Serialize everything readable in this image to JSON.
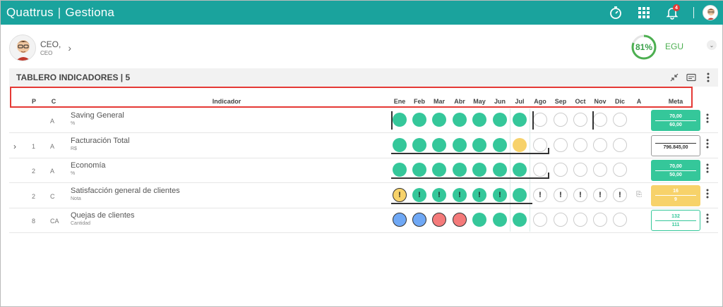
{
  "app": {
    "brand": "Quattrus",
    "module": "Gestiona",
    "notifications": "4"
  },
  "user": {
    "name": "CEO,",
    "role": "CEO"
  },
  "score": {
    "value": "81%",
    "fraction": 0.81,
    "label": "EGU",
    "color": "#4caf50"
  },
  "panel": {
    "title": "TABLERO INDICADORES | 5"
  },
  "columns": {
    "p": "P",
    "c": "C",
    "indicator": "Indicador",
    "months": [
      "Ene",
      "Feb",
      "Mar",
      "Abr",
      "May",
      "Jun",
      "Jul",
      "Ago",
      "Sep",
      "Oct",
      "Nov",
      "Dic"
    ],
    "a": "A",
    "meta": "Meta"
  },
  "rows": [
    {
      "p": "",
      "c": "A",
      "name": "Saving General",
      "unit": "%",
      "expand": false,
      "months": [
        "green",
        "green",
        "green",
        "green",
        "green",
        "green",
        "green",
        "empty",
        "empty",
        "empty",
        "empty",
        "empty"
      ],
      "meta_style": "green",
      "meta_top": "70,00",
      "meta_bottom": "60,00"
    },
    {
      "p": "1",
      "c": "A",
      "name": "Facturación Total",
      "unit": "R$",
      "expand": true,
      "months": [
        "green",
        "green",
        "green",
        "green",
        "green",
        "green",
        "yellow",
        "empty",
        "empty",
        "empty",
        "empty",
        "empty"
      ],
      "meta_style": "white",
      "meta_top": "",
      "meta_bottom": "796.845,00"
    },
    {
      "p": "2",
      "c": "A",
      "name": "Economía",
      "unit": "%",
      "expand": false,
      "months": [
        "green",
        "green",
        "green",
        "green",
        "green",
        "green",
        "green",
        "empty",
        "empty",
        "empty",
        "empty",
        "empty"
      ],
      "meta_style": "green",
      "meta_top": "70,00",
      "meta_bottom": "50,00"
    },
    {
      "p": "2",
      "c": "C",
      "name": "Satisfacción general de clientes",
      "unit": "Nota",
      "expand": false,
      "months": [
        "warn-y",
        "warn-g",
        "warn-g",
        "warn-g",
        "warn-g",
        "warn-g",
        "green",
        "warn-e",
        "warn-e",
        "warn-e",
        "warn-e",
        "warn-e"
      ],
      "meta_style": "yellow",
      "meta_top": "16",
      "meta_bottom": "9"
    },
    {
      "p": "8",
      "c": "CA",
      "name": "Quejas de clientes",
      "unit": "Cantidad",
      "expand": false,
      "months": [
        "blue",
        "blue",
        "red",
        "red",
        "green",
        "green",
        "green",
        "empty",
        "empty",
        "empty",
        "empty",
        "empty"
      ],
      "meta_style": "outline",
      "meta_top": "132",
      "meta_bottom": "111"
    }
  ],
  "icons": {
    "timer": "stopwatch-icon",
    "apps": "grid-icon",
    "bell": "bell-icon",
    "collapse": "collapse-arrows-icon",
    "card": "id-card-icon",
    "more": "kebab-icon",
    "clip": "paperclip-icon",
    "warn": "!",
    "expand": "›",
    "chevron": "›",
    "chevron_down": "⌄"
  }
}
